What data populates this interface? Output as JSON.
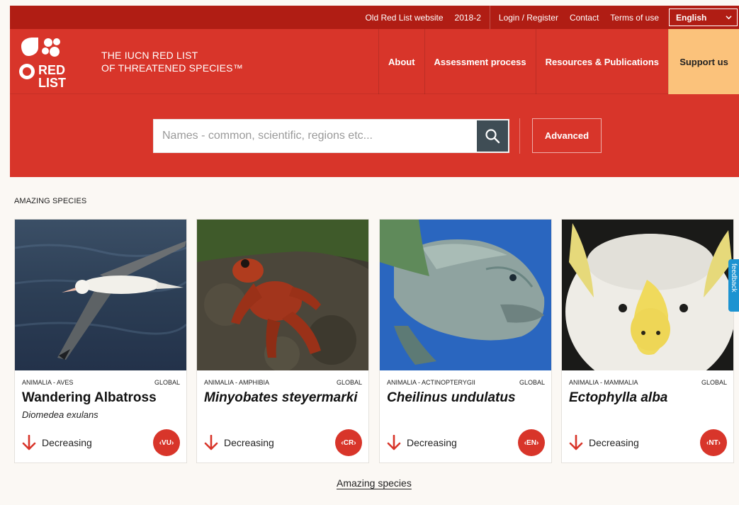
{
  "topbar": {
    "links": [
      "Old Red List website",
      "2018-2",
      "Login / Register",
      "Contact",
      "Terms of use"
    ],
    "language": "English"
  },
  "header": {
    "logo_text": "RED LIST",
    "brand_line1": "THE IUCN RED LIST",
    "brand_line2": "OF THREATENED SPECIES™",
    "nav": [
      "About",
      "Assessment process",
      "Resources & Publications",
      "Support us"
    ]
  },
  "search": {
    "placeholder": "Names - common, scientific, regions etc...",
    "advanced_label": "Advanced"
  },
  "section": {
    "title": "AMAZING SPECIES",
    "footer_link": "Amazing species"
  },
  "cards": [
    {
      "taxon": "ANIMALIA - AVES",
      "scope": "GLOBAL",
      "name": "Wandering Albatross",
      "sci": "Diomedea exulans",
      "trend": "Decreasing",
      "badge": "VU"
    },
    {
      "taxon": "ANIMALIA - AMPHIBIA",
      "scope": "GLOBAL",
      "name": "Minyobates steyermarki",
      "sci": "",
      "trend": "Decreasing",
      "badge": "CR"
    },
    {
      "taxon": "ANIMALIA - ACTINOPTERYGII",
      "scope": "GLOBAL",
      "name": "Cheilinus undulatus",
      "sci": "",
      "trend": "Decreasing",
      "badge": "EN"
    },
    {
      "taxon": "ANIMALIA - MAMMALIA",
      "scope": "GLOBAL",
      "name": "Ectophylla alba",
      "sci": "",
      "trend": "Decreasing",
      "badge": "NT"
    }
  ],
  "feedback_label": "feedback",
  "colors": {
    "brand_red": "#d8352a",
    "dark_red": "#b01d14",
    "support": "#fbc27b",
    "search_button": "#3f4d55"
  }
}
